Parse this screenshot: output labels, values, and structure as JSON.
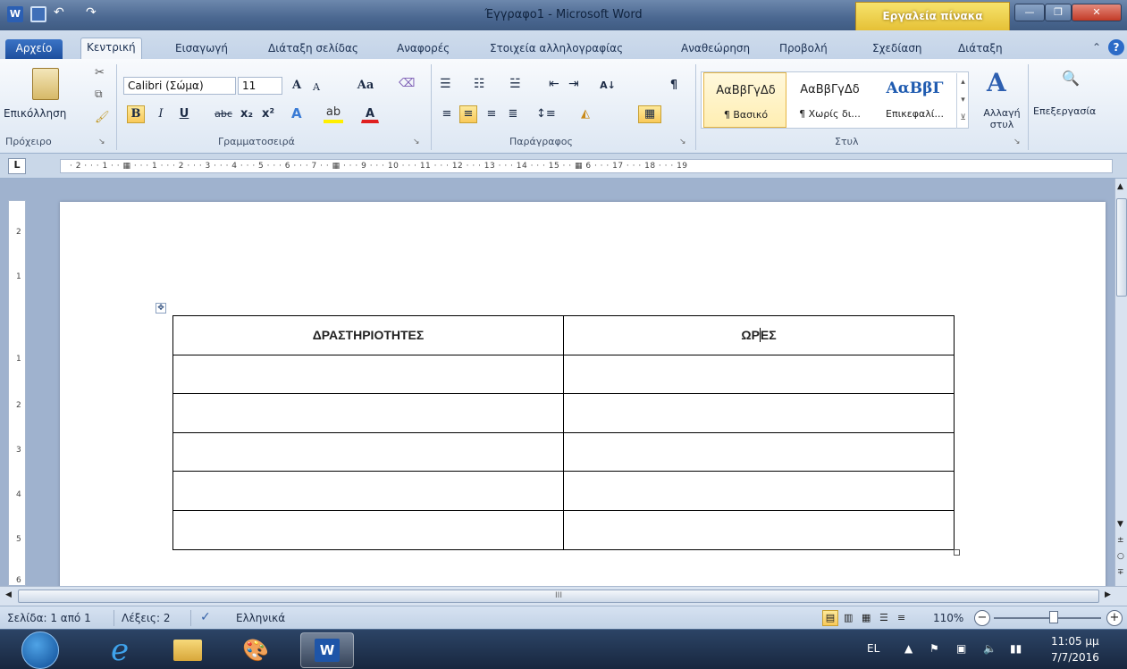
{
  "window": {
    "title": "Έγγραφο1 - Microsoft Word",
    "contextual_tab": "Εργαλεία πίνακα",
    "minimize": "—",
    "maximize": "❐",
    "close": "✕"
  },
  "tabs": [
    {
      "label": "Αρχείο"
    },
    {
      "label": "Κεντρική"
    },
    {
      "label": "Εισαγωγή"
    },
    {
      "label": "Διάταξη σελίδας"
    },
    {
      "label": "Αναφορές"
    },
    {
      "label": "Στοιχεία αλληλογραφίας"
    },
    {
      "label": "Αναθεώρηση"
    },
    {
      "label": "Προβολή"
    },
    {
      "label": "Σχεδίαση"
    },
    {
      "label": "Διάταξη"
    }
  ],
  "ribbon": {
    "clipboard": {
      "paste": "Επικόλληση",
      "group": "Πρόχειρο"
    },
    "font": {
      "family": "Calibri (Σώμα)",
      "size": "11",
      "group": "Γραμματοσειρά",
      "bold": "B",
      "italic": "I",
      "underline": "U",
      "strike": "abc",
      "sub": "x₂",
      "sup": "x²",
      "grow": "A",
      "shrink": "A",
      "case": "Aa",
      "color": "A"
    },
    "paragraph": {
      "group": "Παράγραφος",
      "pilcrow": "¶",
      "sort": "A↓"
    },
    "styles": {
      "group": "Στυλ",
      "items": [
        {
          "sample": "ΑαΒβΓγΔδ",
          "name": "¶ Βασικό"
        },
        {
          "sample": "ΑαΒβΓγΔδ",
          "name": "¶ Χωρίς δι..."
        },
        {
          "sample": "ΑαΒβΓ",
          "name": "Επικεφαλί..."
        }
      ],
      "change": "Αλλαγή στυλ"
    },
    "editing": {
      "label": "Επεξεργασία"
    }
  },
  "ruler": {
    "corner": "L",
    "marks": "· 2 · · · 1 · · ▦ · · · 1 · · · 2 · · · 3 · · · 4 · · · 5 · · · 6 · · · 7 · · ▦ · · · 9 · · · 10 · · · 11 · · · 12 · · · 13 · · · 14 · · · 15 · · ▦ 6 · · · 17 · · · 18 · · · 19"
  },
  "vruler_marks": [
    "2",
    "1",
    "1",
    "2",
    "3",
    "4",
    "5",
    "6"
  ],
  "table": {
    "headers": [
      "ΔΡΑΣΤΗΡΙΟΤΗΤΕΣ",
      "ΩΡΕΣ"
    ],
    "header2_part1": "ΩΡ",
    "header2_part2": "ΕΣ",
    "empty_rows": 5
  },
  "hscroll_grip": "III",
  "status": {
    "page": "Σελίδα: 1 από 1",
    "words": "Λέξεις: 2",
    "language": "Ελληνικά",
    "zoom": "110%"
  },
  "taskbar": {
    "lang": "EL",
    "time": "11:05 μμ",
    "date": "7/7/2016"
  }
}
